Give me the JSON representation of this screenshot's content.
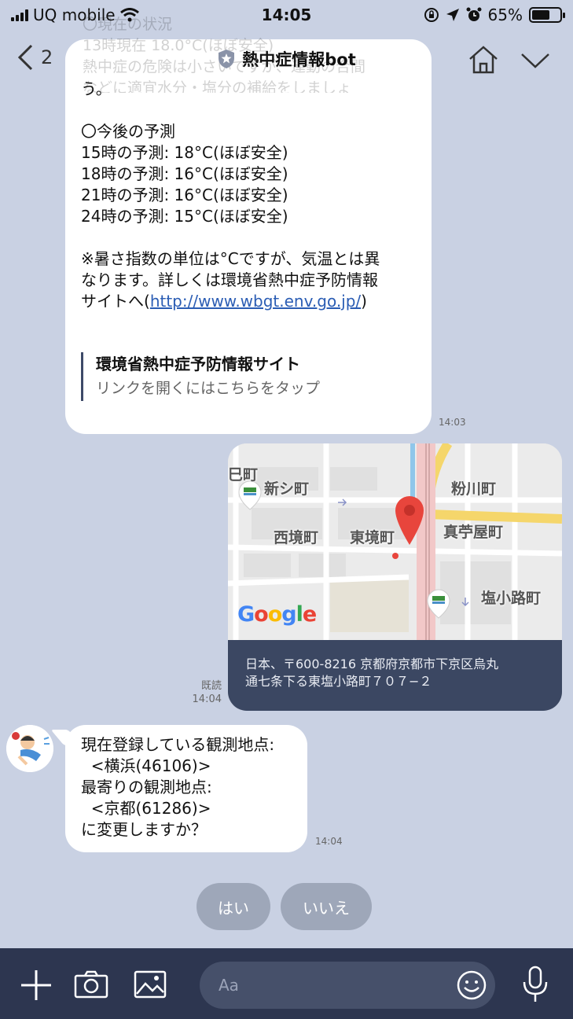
{
  "status": {
    "carrier": "UQ mobile",
    "time": "14:05",
    "battery": "65%",
    "battery_level": 0.65
  },
  "header": {
    "back_count": "2",
    "title": "熱中症情報bot",
    "ghost_lines": [
      "〇現在の状況",
      "13時現在 18.0°C(ほぼ安全)",
      "熱中症の危険は小さいですが、運動の合間",
      "などに適宜水分・塩分の補給をしましょ"
    ]
  },
  "message1": {
    "lines": [
      "う。",
      "",
      "〇今後の予測",
      "15時の予測: 18°C(ほぼ安全)",
      "18時の予測: 16°C(ほぼ安全)",
      "21時の予測: 16°C(ほぼ安全)",
      "24時の予測: 15°C(ほぼ安全)",
      "",
      "※暑さ指数の単位は°Cですが、気温とは異",
      "なります。詳しくは環境省熱中症予防情報"
    ],
    "last_line_prefix": "サイトへ(",
    "link_text": "http://www.wbgt.env.go.jp/",
    "last_line_suffix": ")",
    "preview_title": "環境省熱中症予防情報サイト",
    "preview_sub": "リンクを開くにはこちらをタップ",
    "time": "14:03"
  },
  "location_message": {
    "map_labels": [
      "巳町",
      "新シ町",
      "粉川町",
      "西境町",
      "東境町",
      "真苧屋町",
      "塩小路町"
    ],
    "google_letters": [
      "G",
      "o",
      "o",
      "g",
      "l",
      "e"
    ],
    "address_line1": "日本、〒600-8216 京都府京都市下京区烏丸",
    "address_line2": "通七条下る東塩小路町７０７−２",
    "read": "既読",
    "time": "14:04"
  },
  "message2": {
    "lines": [
      "現在登録している観測地点:",
      "  <横浜(46106)>",
      "最寄りの観測地点:",
      "  <京都(61286)>",
      "に変更しますか？"
    ],
    "time": "14:04"
  },
  "quick_replies": {
    "yes": "はい",
    "no": "いいえ"
  },
  "input": {
    "placeholder": "Aa"
  },
  "icons": [
    "signal-icon",
    "wifi-icon",
    "lock-rotation-icon",
    "location-icon",
    "alarm-icon",
    "battery-icon",
    "back-chevron-icon",
    "shield-icon",
    "home-icon",
    "chevron-down-icon",
    "plus-icon",
    "camera-icon",
    "image-icon",
    "smile-icon",
    "mic-icon",
    "map-pin-icon"
  ],
  "colors": {
    "background": "#c9d1e3",
    "bubble": "#ffffff",
    "link": "#2b5db4",
    "bottom_bar": "#2d3650",
    "address_bg": "#3b4762",
    "quick_reply": "#9ea7b9",
    "pin": "#e8453c"
  }
}
